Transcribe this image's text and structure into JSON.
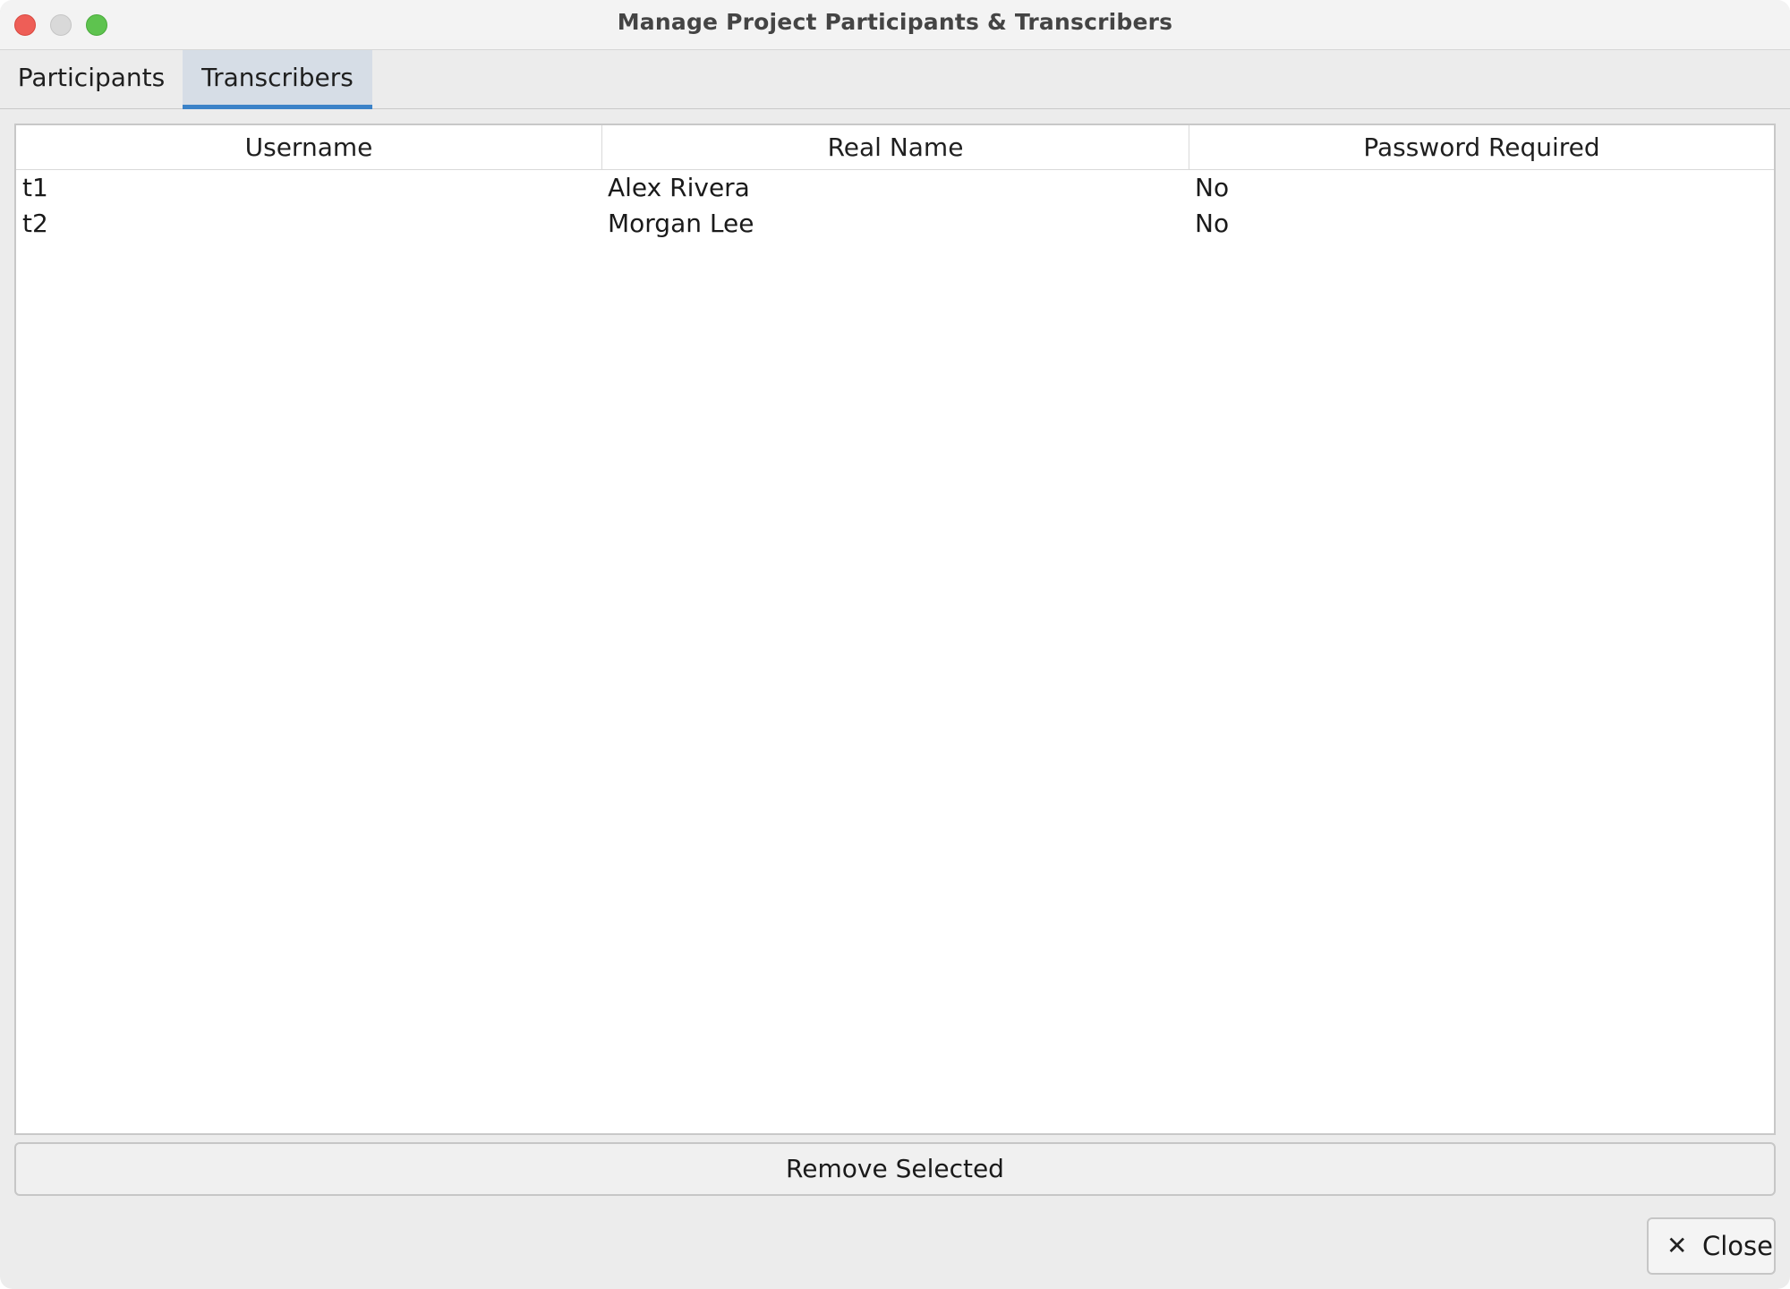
{
  "window": {
    "title": "Manage Project Participants & Transcribers"
  },
  "tabs": [
    {
      "label": "Participants",
      "selected": false
    },
    {
      "label": "Transcribers",
      "selected": true
    }
  ],
  "table": {
    "columns": [
      "Username",
      "Real Name",
      "Password Required"
    ],
    "rows": [
      [
        "t1",
        "Alex Rivera",
        "No"
      ],
      [
        "t2",
        "Morgan Lee",
        "No"
      ]
    ]
  },
  "actions": {
    "remove_label": "Remove Selected",
    "close_label": "Close",
    "close_icon": "✕"
  },
  "colors": {
    "close_light": "#ee5e57",
    "minimize_light": "#d9d9d9",
    "maximize_light": "#5ec34f",
    "tab_selected_accent": "#3b82c8"
  }
}
